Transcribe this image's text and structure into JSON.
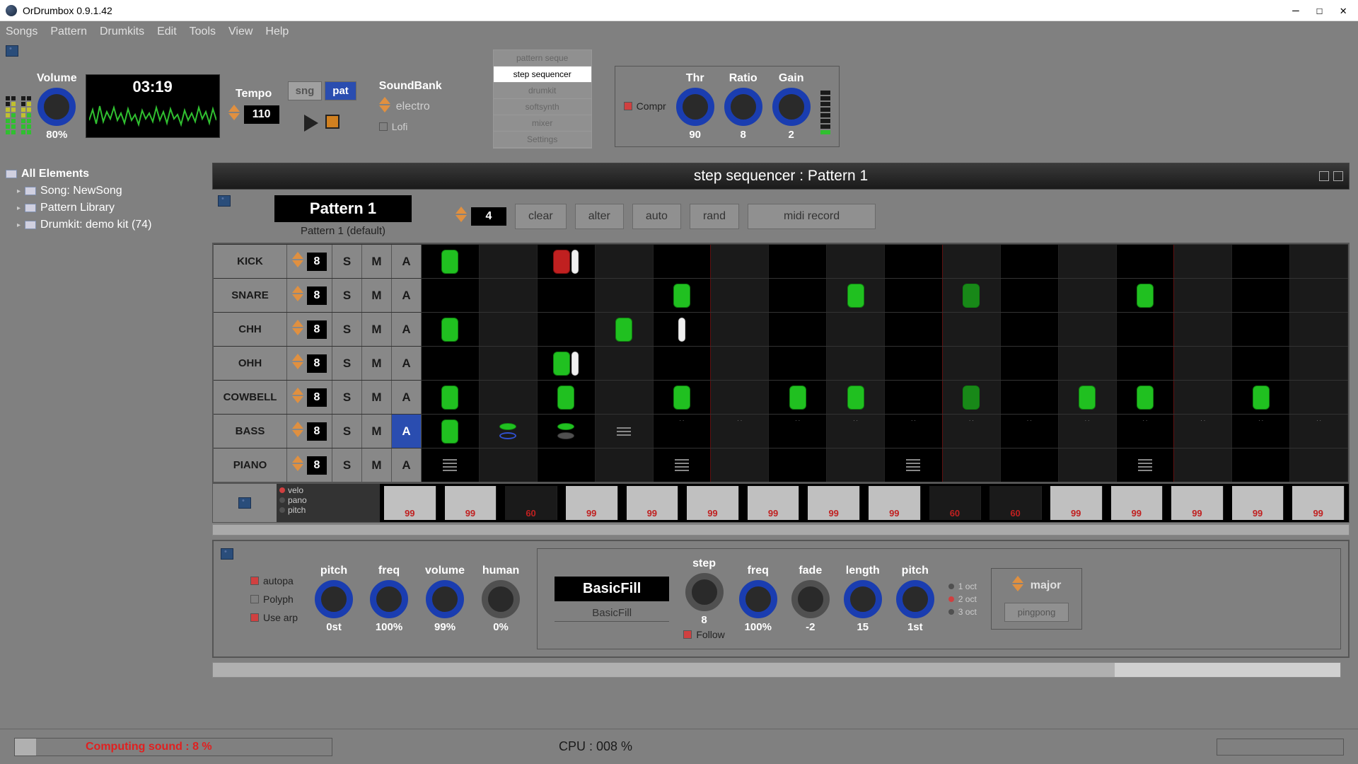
{
  "window": {
    "title": "OrDrumbox 0.9.1.42"
  },
  "menu": [
    "Songs",
    "Pattern",
    "Drumkits",
    "Edit",
    "Tools",
    "View",
    "Help"
  ],
  "top": {
    "volume": {
      "label": "Volume",
      "value": "80%"
    },
    "time": "03:19",
    "tempo": {
      "label": "Tempo",
      "value": "110"
    },
    "modes": {
      "sng": "sng",
      "pat": "pat"
    },
    "soundbank": {
      "label": "SoundBank",
      "value": "electro",
      "lofi": "Lofi"
    },
    "tabs": [
      "pattern seque",
      "step sequencer",
      "drumkit",
      "softsynth",
      "mixer",
      "Settings"
    ],
    "compr": {
      "label": "Compr",
      "thr": {
        "label": "Thr",
        "value": "90"
      },
      "ratio": {
        "label": "Ratio",
        "value": "8"
      },
      "gain": {
        "label": "Gain",
        "value": "2"
      }
    }
  },
  "tree": {
    "root": "All Elements",
    "song": "Song: NewSong",
    "patlib": "Pattern Library",
    "drumkit": "Drumkit: demo kit (74)"
  },
  "seq": {
    "title": "step sequencer : Pattern 1",
    "pattern_name": "Pattern 1",
    "pattern_sub": "Pattern 1 (default)",
    "bars": "4",
    "actions": {
      "clear": "clear",
      "alter": "alter",
      "auto": "auto",
      "rand": "rand",
      "midi": "midi record"
    },
    "tracks": [
      {
        "name": "KICK",
        "steps": "8",
        "s": "S",
        "m": "M",
        "a": "A"
      },
      {
        "name": "SNARE",
        "steps": "8",
        "s": "S",
        "m": "M",
        "a": "A"
      },
      {
        "name": "CHH",
        "steps": "8",
        "s": "S",
        "m": "M",
        "a": "A"
      },
      {
        "name": "OHH",
        "steps": "8",
        "s": "S",
        "m": "M",
        "a": "A"
      },
      {
        "name": "COWBELL",
        "steps": "8",
        "s": "S",
        "m": "M",
        "a": "A"
      },
      {
        "name": "BASS",
        "steps": "8",
        "s": "S",
        "m": "M",
        "a": "A"
      },
      {
        "name": "PIANO",
        "steps": "8",
        "s": "S",
        "m": "M",
        "a": "A"
      }
    ],
    "velo_opts": [
      "velo",
      "pano",
      "pitch"
    ],
    "velo_vals": [
      "99",
      "99",
      "60",
      "99",
      "99",
      "99",
      "99",
      "99",
      "99",
      "60",
      "60",
      "99",
      "99",
      "99",
      "99",
      "99"
    ]
  },
  "bottom": {
    "opts": {
      "autopa": "autopa",
      "polyph": "Polyph",
      "usearp": "Use arp"
    },
    "knobs": {
      "pitch": {
        "label": "pitch",
        "value": "0st"
      },
      "freq": {
        "label": "freq",
        "value": "100%"
      },
      "volume": {
        "label": "volume",
        "value": "99%"
      },
      "human": {
        "label": "human",
        "value": "0%"
      }
    },
    "fill": {
      "name": "BasicFill",
      "sub": "BasicFill",
      "follow": "Follow",
      "step": {
        "label": "step",
        "value": "8"
      },
      "freq": {
        "label": "freq",
        "value": "100%"
      },
      "fade": {
        "label": "fade",
        "value": "-2"
      },
      "length": {
        "label": "length",
        "value": "15"
      },
      "pitch": {
        "label": "pitch",
        "value": "1st"
      }
    },
    "octs": [
      "1 oct",
      "2 oct",
      "3 oct"
    ],
    "scale": {
      "value": "major",
      "pp": "pingpong"
    }
  },
  "status": {
    "computing": "Computing sound : 8 %",
    "cpu": "CPU : 008 %"
  }
}
